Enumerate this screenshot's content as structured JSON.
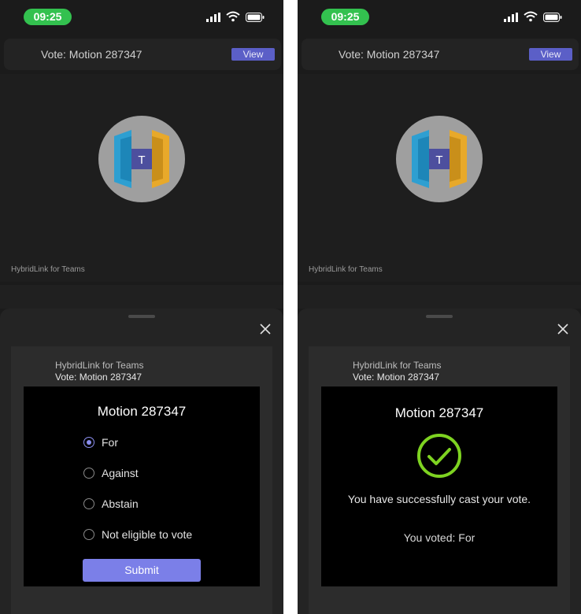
{
  "status_bar": {
    "time": "09:25"
  },
  "header": {
    "title": "Vote: Motion 287347",
    "view_label": "View"
  },
  "stage": {
    "label": "HybridLink for Teams",
    "logo_letter": "T"
  },
  "card": {
    "app_name": "HybridLink for Teams",
    "subtitle": "Vote: Motion 287347"
  },
  "vote_form": {
    "title": "Motion 287347",
    "options": [
      "For",
      "Against",
      "Abstain",
      "Not eligible to vote"
    ],
    "selected": "For",
    "submit_label": "Submit"
  },
  "confirmation": {
    "title": "Motion 287347",
    "message": "You have successfully cast your vote.",
    "voted_text": "You voted: For"
  },
  "colors": {
    "accent": "#7b7fe8",
    "status_green": "#33c14f",
    "success_ring": "#7ed321",
    "background": "#1b1b1b"
  }
}
